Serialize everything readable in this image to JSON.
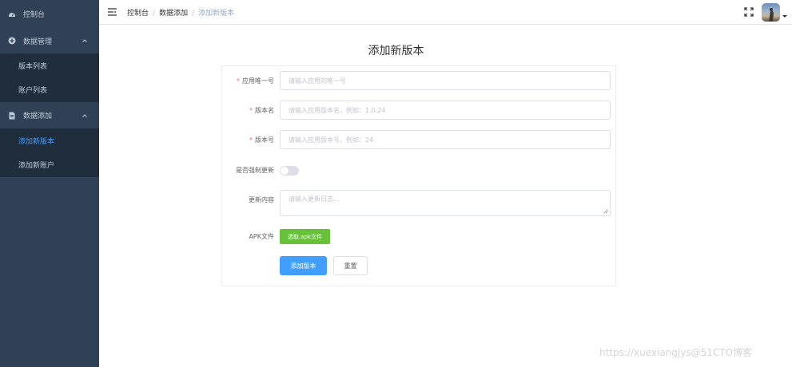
{
  "sidebar": {
    "items": [
      {
        "label": "控制台",
        "icon": "dashboard-icon"
      },
      {
        "label": "数据管理",
        "icon": "plus-circle-icon"
      },
      {
        "label": "版本列表"
      },
      {
        "label": "账户列表"
      },
      {
        "label": "数据添加",
        "icon": "document-icon"
      },
      {
        "label": "添加新版本"
      },
      {
        "label": "添加新账户"
      }
    ]
  },
  "breadcrumb": [
    "控制台",
    "数据添加",
    "添加新版本"
  ],
  "form": {
    "title": "添加新版本",
    "fields": [
      {
        "label": "应用唯一号",
        "required": true,
        "placeholder": "请输入应用的唯一号"
      },
      {
        "label": "版本名",
        "required": true,
        "placeholder": "请输入应用版本名，例如：1.0.24"
      },
      {
        "label": "版本号",
        "required": true,
        "placeholder": "请输入应用版本号，例如：24"
      }
    ],
    "force_update_label": "是否强制更新",
    "force_update_value": false,
    "changelog_label": "更新内容",
    "changelog_placeholder": "请输入更新日志...",
    "apk_label": "APK文件",
    "apk_button": "选取.apk文件",
    "submit_button": "添加版本",
    "reset_button": "重置"
  },
  "colors": {
    "sidebar_bg": "#304156",
    "accent": "#409eff",
    "success": "#67c23a",
    "required": "#f56c6c"
  },
  "watermark": "https://xuexiangjys@51CTO博客"
}
